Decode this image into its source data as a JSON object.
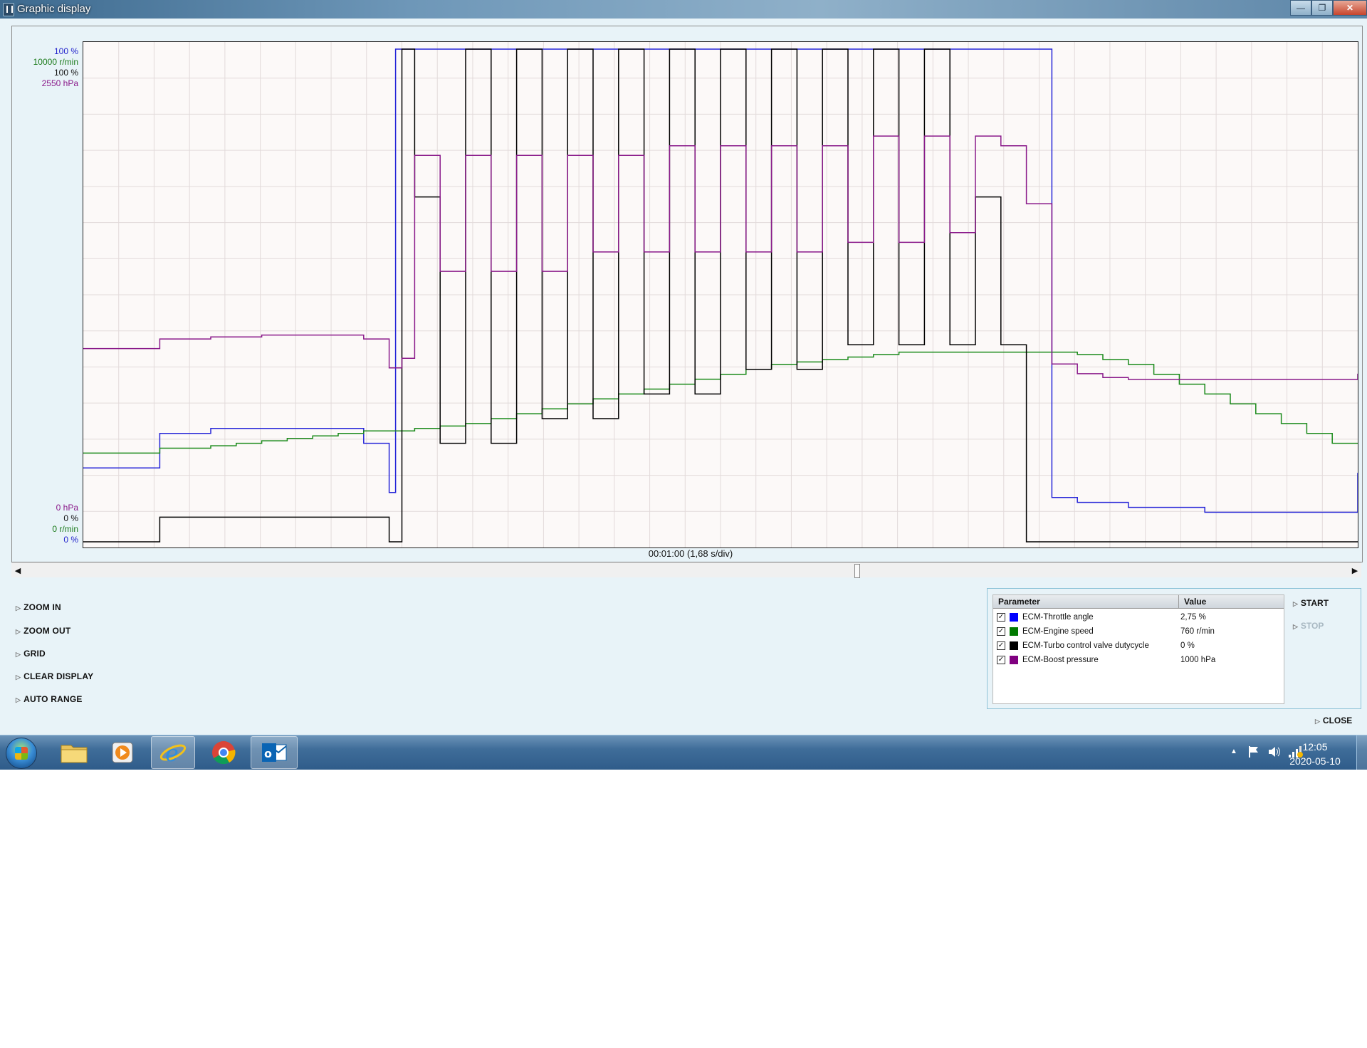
{
  "window": {
    "title": "Graphic display",
    "buttons": {
      "minimize": "—",
      "maximize": "❐",
      "close": "✕"
    }
  },
  "axis_labels": {
    "top": [
      "100 %",
      "10000 r/min",
      "100 %",
      "2550 hPa"
    ],
    "bottom": [
      "0 hPa",
      "0 %",
      "0 r/min",
      "0 %"
    ],
    "colors_top": [
      "#2222cc",
      "#1a7a1a",
      "#111111",
      "#8a1a8a"
    ],
    "colors_bottom": [
      "#8a1a8a",
      "#111111",
      "#1a7a1a",
      "#2222cc"
    ]
  },
  "time_axis_label": "00:01:00 (1,68 s/div)",
  "commands": [
    "ZOOM IN",
    "ZOOM OUT",
    "GRID",
    "CLEAR DISPLAY",
    "AUTO RANGE"
  ],
  "parameters": {
    "header": {
      "name": "Parameter",
      "value": "Value"
    },
    "rows": [
      {
        "name": "ECM-Throttle angle",
        "value": "2,75 %",
        "color": "#0000ff",
        "checked": true
      },
      {
        "name": "ECM-Engine speed",
        "value": "760 r/min",
        "color": "#007a00",
        "checked": true
      },
      {
        "name": "ECM-Turbo control valve dutycycle",
        "value": "0 %",
        "color": "#000000",
        "checked": true
      },
      {
        "name": "ECM-Boost pressure",
        "value": "1000 hPa",
        "color": "#800080",
        "checked": true
      }
    ]
  },
  "side_buttons": {
    "start": "START",
    "stop": "STOP",
    "close": "CLOSE"
  },
  "taskbar": {
    "apps": [
      "file-explorer-icon",
      "media-player-icon",
      "internet-explorer-icon",
      "chrome-icon",
      "outlook-icon"
    ],
    "time": "12:05",
    "date": "2020-05-10",
    "tray_icons": [
      "show-hidden-icons-icon",
      "action-center-flag-icon",
      "volume-icon",
      "network-icon"
    ]
  },
  "chart_data": {
    "type": "line",
    "x": [
      0,
      0.02,
      0.04,
      0.06,
      0.08,
      0.1,
      0.12,
      0.14,
      0.16,
      0.18,
      0.2,
      0.22,
      0.24,
      0.245,
      0.25,
      0.26,
      0.28,
      0.3,
      0.32,
      0.34,
      0.36,
      0.38,
      0.4,
      0.42,
      0.44,
      0.46,
      0.48,
      0.5,
      0.52,
      0.54,
      0.56,
      0.58,
      0.6,
      0.62,
      0.64,
      0.66,
      0.68,
      0.7,
      0.72,
      0.74,
      0.76,
      0.78,
      0.8,
      0.82,
      0.84,
      0.86,
      0.88,
      0.9,
      0.92,
      0.94,
      0.96,
      0.98,
      1.0
    ],
    "x_range": [
      0,
      1
    ],
    "grid": true,
    "series": [
      {
        "name": "ECM-Throttle angle",
        "unit": "%",
        "range": [
          0,
          100
        ],
        "color": "#2424d8",
        "values": [
          15,
          15,
          15,
          22,
          22,
          23,
          23,
          23,
          23,
          23,
          23,
          20,
          10,
          100,
          100,
          100,
          100,
          100,
          100,
          100,
          100,
          100,
          100,
          100,
          100,
          100,
          100,
          100,
          100,
          100,
          100,
          100,
          100,
          100,
          100,
          100,
          100,
          100,
          100,
          100,
          9,
          8,
          8,
          7,
          7,
          7,
          6,
          6,
          6,
          6,
          6,
          6,
          14
        ]
      },
      {
        "name": "ECM-Engine speed",
        "unit": "r/min",
        "range": [
          0,
          10000
        ],
        "color": "#1a8a1a",
        "values": [
          1800,
          1800,
          1800,
          1900,
          1900,
          1950,
          2000,
          2050,
          2100,
          2150,
          2200,
          2250,
          2250,
          2250,
          2250,
          2300,
          2350,
          2400,
          2500,
          2600,
          2700,
          2800,
          2900,
          3000,
          3100,
          3200,
          3300,
          3400,
          3500,
          3600,
          3650,
          3700,
          3750,
          3800,
          3850,
          3850,
          3850,
          3850,
          3850,
          3850,
          3850,
          3800,
          3700,
          3600,
          3400,
          3200,
          3000,
          2800,
          2600,
          2400,
          2200,
          2000,
          2000
        ]
      },
      {
        "name": "ECM-Turbo control valve dutycycle",
        "unit": "%",
        "range": [
          0,
          100
        ],
        "color": "#000000",
        "values": [
          0,
          0,
          0,
          5,
          5,
          5,
          5,
          5,
          5,
          5,
          5,
          5,
          0,
          0,
          100,
          70,
          20,
          100,
          20,
          100,
          25,
          100,
          25,
          100,
          30,
          100,
          30,
          100,
          35,
          100,
          35,
          100,
          40,
          100,
          40,
          100,
          40,
          70,
          40,
          0,
          0,
          0,
          0,
          0,
          0,
          0,
          0,
          0,
          0,
          0,
          0,
          0,
          0
        ]
      },
      {
        "name": "ECM-Boost pressure",
        "unit": "hPa",
        "range": [
          0,
          2550
        ],
        "color": "#8a1a8a",
        "values": [
          1000,
          1000,
          1000,
          1050,
          1050,
          1060,
          1060,
          1070,
          1070,
          1070,
          1070,
          1050,
          900,
          900,
          950,
          2000,
          1400,
          2000,
          1400,
          2000,
          1400,
          2000,
          1500,
          2000,
          1500,
          2050,
          1500,
          2050,
          1500,
          2050,
          1500,
          2050,
          1550,
          2100,
          1550,
          2100,
          1600,
          2100,
          2050,
          1750,
          920,
          870,
          850,
          840,
          840,
          840,
          840,
          840,
          840,
          840,
          840,
          840,
          870
        ]
      }
    ]
  }
}
